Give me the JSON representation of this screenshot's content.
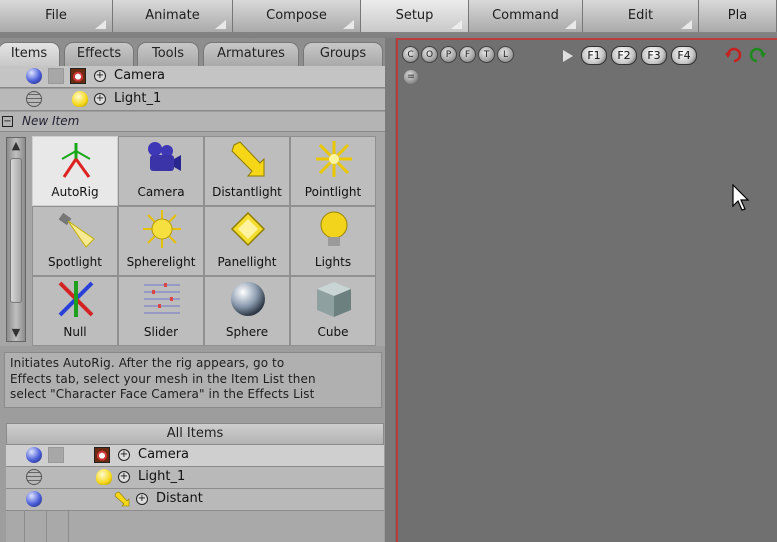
{
  "menu": [
    "File",
    "Animate",
    "Compose",
    "Setup",
    "Command",
    "Edit",
    "Pla"
  ],
  "tabs": [
    "Items",
    "Effects",
    "Tools",
    "Armatures",
    "Groups"
  ],
  "top_items": [
    {
      "name": "Camera",
      "icon": "camera-icon"
    },
    {
      "name": "Light_1",
      "icon": "bulb-icon"
    }
  ],
  "new_item": {
    "toggle": "−",
    "label": "New Item"
  },
  "grid": [
    {
      "label": "AutoRig",
      "icon": "autorig-icon"
    },
    {
      "label": "Camera",
      "icon": "camera-icon"
    },
    {
      "label": "Distantlight",
      "icon": "distantlight-icon"
    },
    {
      "label": "Pointlight",
      "icon": "pointlight-icon"
    },
    {
      "label": "Spotlight",
      "icon": "spotlight-icon"
    },
    {
      "label": "Spherelight",
      "icon": "spherelight-icon"
    },
    {
      "label": "Panellight",
      "icon": "panellight-icon"
    },
    {
      "label": "Lights",
      "icon": "lights-icon"
    },
    {
      "label": "Null",
      "icon": "null-icon"
    },
    {
      "label": "Slider",
      "icon": "slider-icon"
    },
    {
      "label": "Sphere",
      "icon": "sphere-icon"
    },
    {
      "label": "Cube",
      "icon": "cube-icon"
    }
  ],
  "description": [
    "Initiates AutoRig.  After the rig appears, go to",
    "Effects tab, select your mesh in the Item List then",
    "select \"Character Face Camera\" in the Effects List"
  ],
  "all_items": {
    "header": "All Items",
    "rows": [
      {
        "name": "Camera",
        "icon": "camera-icon"
      },
      {
        "name": "Light_1",
        "icon": "bulb-icon"
      },
      {
        "name": "Distant",
        "icon": "distantlight-icon"
      }
    ]
  },
  "viewport": {
    "view_buttons": [
      "C",
      "O",
      "P",
      "F",
      "T",
      "L"
    ],
    "function_buttons": [
      "F1",
      "F2",
      "F3",
      "F4"
    ],
    "equals_button": "="
  },
  "colors": {
    "viewport_border": "#b93b3b",
    "selection": "#e8e8e8",
    "light_yellow": "#f5d718",
    "object_blue": "#4a5ed8"
  }
}
